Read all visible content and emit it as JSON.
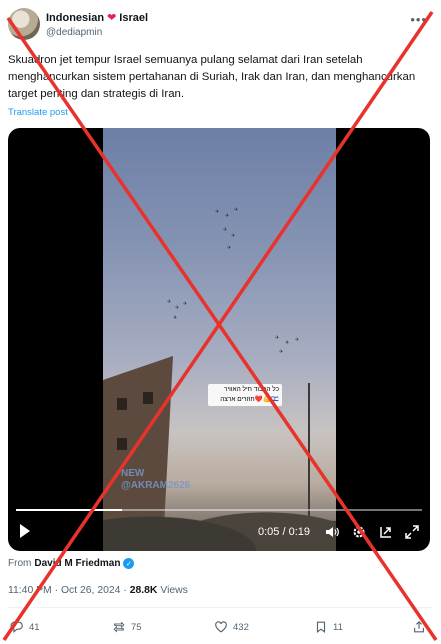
{
  "author": {
    "name_part1": "Indonesian",
    "name_part2": "Israel",
    "handle": "@dediapmin"
  },
  "tweet": {
    "text": "Skuadron jet tempur Israel semuanya pulang selamat dari Iran setelah menghancurkan sistem pertahanan di Suriah, Irak dan Iran, dan menghancurkan target penting dan strategis di Iran.",
    "translate_label": "Translate post"
  },
  "video": {
    "overlay_line1": "כל הכבוד חיל האוויר",
    "overlay_line2": "חוזרים ארצה❤️💪🇮🇱",
    "watermark_line1": "NEW",
    "watermark_line2": "@AKRAM2626",
    "time": "0:05 / 0:19",
    "progress": 0.26
  },
  "source": {
    "prefix": "From",
    "name": "David M Friedman"
  },
  "meta": {
    "time": "11:40 PM",
    "date": "Oct 26, 2024",
    "views": "28.8K",
    "views_label": "Views"
  },
  "actions": {
    "replies": "41",
    "reposts": "75",
    "likes": "432",
    "bookmarks": "11"
  },
  "colors": {
    "accent": "#1d9bf0",
    "cross": "#e8322c",
    "heart": "#e0245e"
  }
}
